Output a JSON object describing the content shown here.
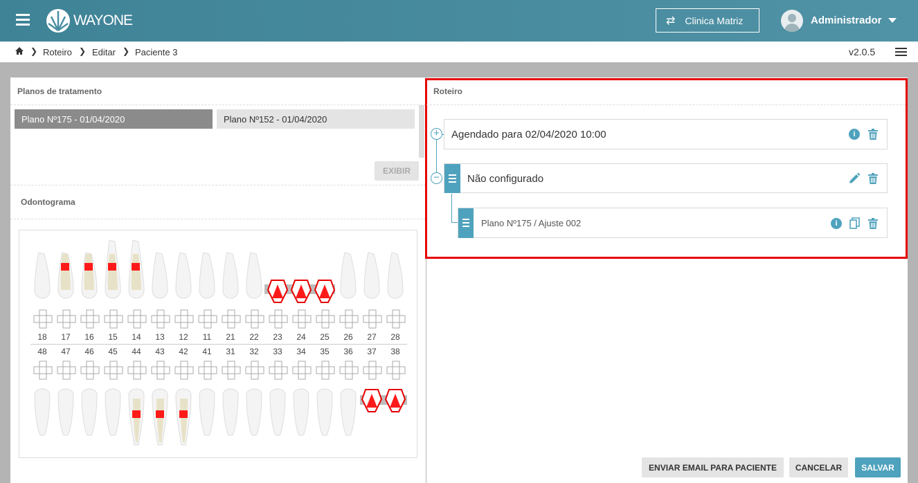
{
  "app": {
    "logo_text": "WAYONE",
    "clinic_button": "Clinica Matriz",
    "user_name": "Administrador"
  },
  "breadcrumb": {
    "items": [
      "Roteiro",
      "Editar",
      "Paciente 3"
    ],
    "version": "v2.0.5"
  },
  "plans": {
    "title": "Planos de tratamento",
    "items": [
      "Plano Nº175 - 01/04/2020",
      "Plano Nº152 - 01/04/2020"
    ],
    "exhibit_button": "EXIBIR"
  },
  "odontogram": {
    "title": "Odontograma",
    "upper_numbers": [
      "18",
      "17",
      "16",
      "15",
      "14",
      "13",
      "12",
      "11",
      "21",
      "22",
      "23",
      "24",
      "25",
      "26",
      "27",
      "28"
    ],
    "lower_numbers": [
      "48",
      "47",
      "46",
      "45",
      "44",
      "43",
      "42",
      "41",
      "31",
      "32",
      "33",
      "34",
      "35",
      "36",
      "37",
      "38"
    ]
  },
  "roteiro": {
    "title": "Roteiro",
    "scheduled": "Agendado para 02/04/2020 10:00",
    "not_configured": "Não configurado",
    "plan_item": "Plano Nº175 / Ajuste 002"
  },
  "actions": {
    "email": "ENVIAR EMAIL PARA PACIENTE",
    "cancel": "CANCELAR",
    "save": "SALVAR"
  },
  "colors": {
    "header": "#4a8ea3",
    "accent": "#4fa2bd",
    "highlight_border": "#e50000",
    "marker": "#ff1a1a"
  }
}
